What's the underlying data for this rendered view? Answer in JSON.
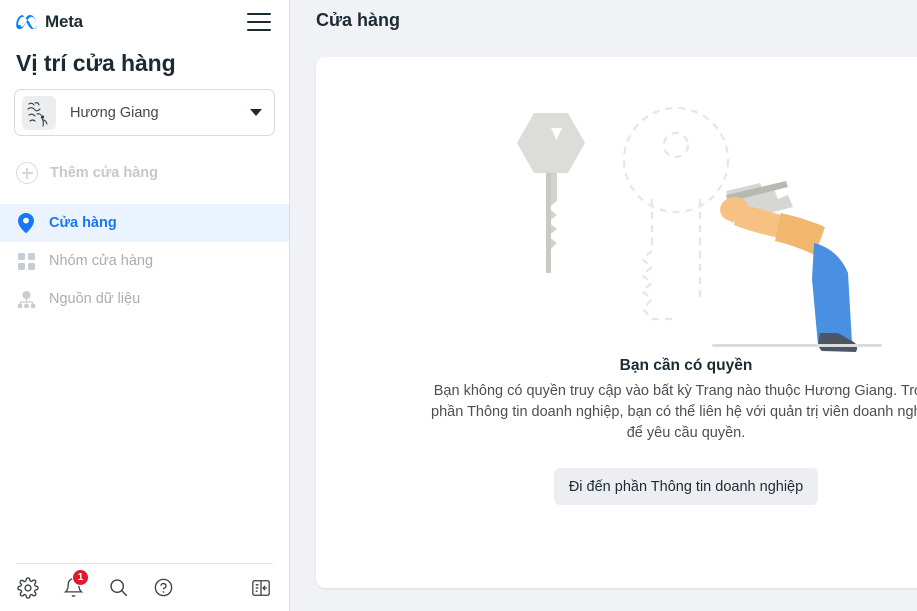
{
  "sidebar": {
    "brand": "Meta",
    "menu_icon": "hamburger-icon",
    "title": "Vị trí cửa hàng",
    "store_selector": {
      "name": "Hương Giang",
      "caret_icon": "chevron-down-icon"
    },
    "add_store": {
      "label": "Thêm cửa hàng",
      "icon": "plus-circle-icon",
      "disabled": true
    },
    "nav_items": [
      {
        "label": "Cửa hàng",
        "icon": "location-pin-icon",
        "active": true
      },
      {
        "label": "Nhóm cửa hàng",
        "icon": "grid-icon",
        "active": false
      },
      {
        "label": "Nguồn dữ liệu",
        "icon": "data-source-icon",
        "active": false
      }
    ],
    "footer": {
      "settings_icon": "gear-icon",
      "notifications_icon": "bell-icon",
      "notifications_count": "1",
      "search_icon": "search-icon",
      "help_icon": "help-circle-icon",
      "collapse_icon": "collapse-panel-icon"
    }
  },
  "main": {
    "title": "Cửa hàng",
    "empty_state": {
      "illustration": "keys-permission-illustration",
      "heading": "Bạn cần có quyền",
      "body": "Bạn không có quyền truy cập vào bất kỳ Trang nào thuộc Hương Giang. Trong phần Thông tin doanh nghiệp, bạn có thể liên hệ với quản trị viên doanh nghiệp để yêu cầu quyền.",
      "cta_label": "Đi đến phần Thông tin doanh nghiệp"
    }
  },
  "colors": {
    "brand_blue": "#1877f2",
    "active_nav_bg": "#ebf3fe",
    "badge_red": "#e4162b",
    "page_bg": "#f0f2f5",
    "card_bg": "#ffffff",
    "text_primary": "#1c2b33",
    "text_muted": "#a9adb4"
  }
}
